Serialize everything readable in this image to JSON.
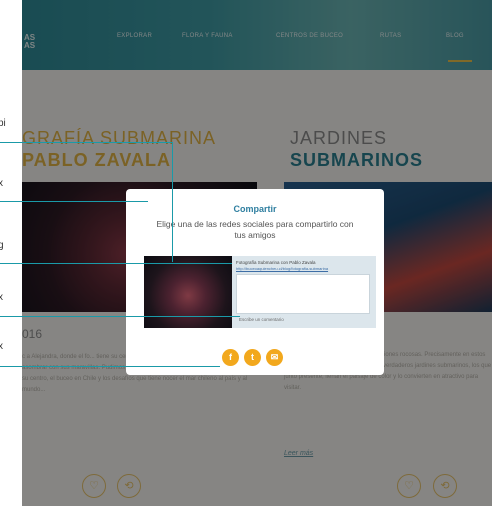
{
  "nav": {
    "logo": [
      "AS",
      "AS"
    ],
    "items": [
      "EXPLORAR",
      "FLORA Y FAUNA",
      "CENTROS DE BUCEO",
      "RUTAS",
      "BLOG"
    ]
  },
  "left_column": {
    "title_line1": "GRAFÍA SUBMARINA",
    "title_line2": "PABLO ZAVALA",
    "year": "016",
    "paragraph": "c a Alejandra, donde el fo... tiene su centro de buceo... esta localidad, dejándonos asombrar con sus maravillas. Pudimos conversar con este gran buzo chileno, el cual tre su centro, el buceo en Chile y los desafíos que tiene nocer el mar chileno al país y al mundo..."
  },
  "right_column": {
    "title_line1": "JARDINES",
    "title_line2": "SUBMARINOS",
    "paragraph": "...paisajes maravillosos. ...des formaciones rocosas. Precisamente en estos se acentúa la vida marina, los dones verdaderos jardines submarinos, los que junto presente, llenan el paisaje de color y lo convierten en atractivo para visitar.",
    "read_more": "Leer más"
  },
  "modal": {
    "title": "Compartir",
    "subtitle": "Elige una de las redes sociales para compartirlo con tus amigos",
    "card_title": "Fotografía Submarina con Pablo Zavala",
    "card_url": "http://buceoaquiencheu.cl/blog/fotografia-submarina",
    "card_placeholder": "Escribe un comentario"
  },
  "callout_labels": [
    "pi",
    "x",
    "g",
    "x",
    "x"
  ],
  "icons": {
    "facebook": "f",
    "twitter": "t",
    "mail": "✉",
    "heart": "♡",
    "share": "⟲"
  },
  "colors": {
    "accent_gold": "#e0b244",
    "accent_teal": "#2a7f8f",
    "social_orange": "#f2a81d"
  }
}
